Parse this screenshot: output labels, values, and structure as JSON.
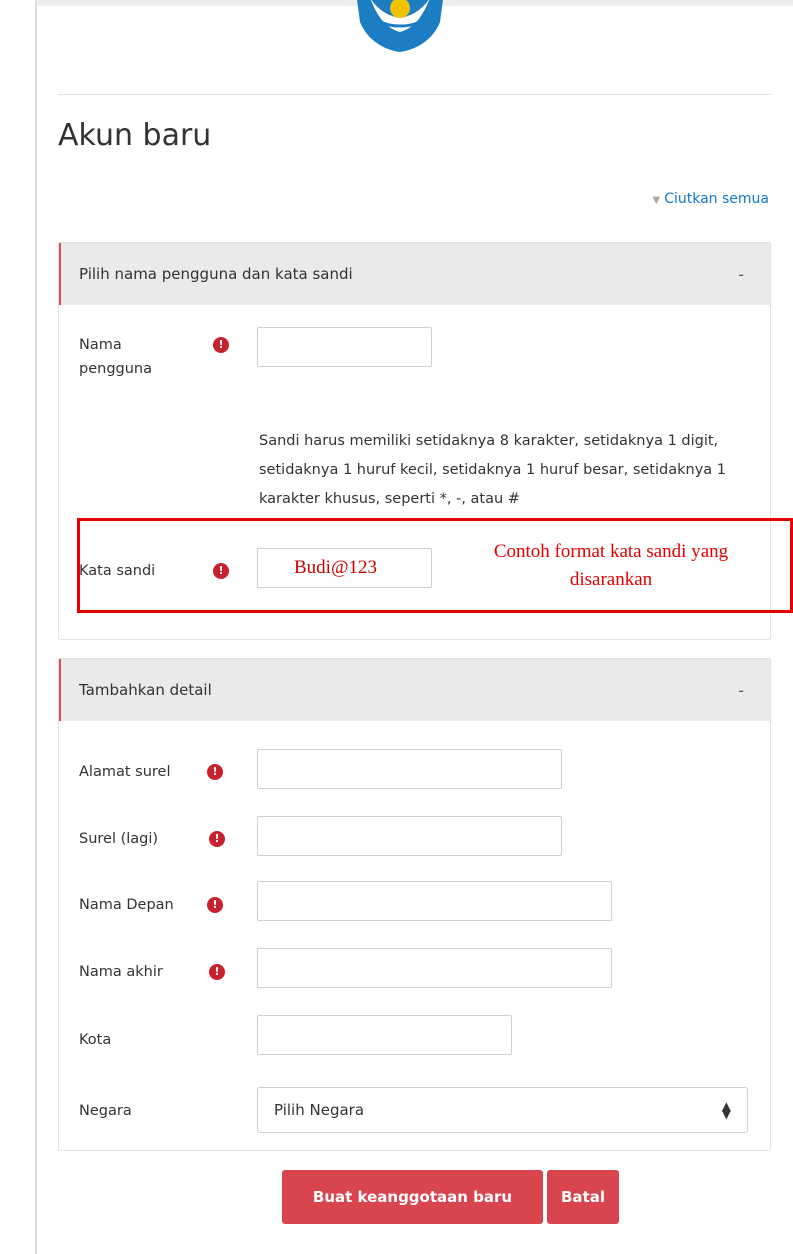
{
  "page": {
    "title": "Akun baru",
    "collapse_all": "Ciutkan semua"
  },
  "section1": {
    "header": "Pilih nama pengguna dan kata sandi",
    "toggle": "-",
    "username_label": "Nama pengguna",
    "password_hint": "Sandi harus memiliki setidaknya 8 karakter, setidaknya 1 digit, setidaknya 1 huruf kecil, setidaknya 1 huruf besar, setidaknya 1 karakter khusus, seperti *, -, atau #",
    "password_label": "Kata sandi",
    "password_value": "Budi@123",
    "annotation": "Contoh format kata sandi yang disarankan"
  },
  "section2": {
    "header": "Tambahkan detail",
    "toggle": "-",
    "email_label": "Alamat surel",
    "email_again_label": "Surel (lagi)",
    "first_name_label": "Nama Depan",
    "last_name_label": "Nama akhir",
    "city_label": "Kota",
    "country_label": "Negara",
    "country_selected": "Pilih Negara"
  },
  "buttons": {
    "submit": "Buat keanggotaan baru",
    "cancel": "Batal"
  },
  "required_icon": "!",
  "colors": {
    "accent": "#d9454f",
    "required": "#c7212e",
    "link": "#1177d1",
    "annotation": "#e60000"
  }
}
